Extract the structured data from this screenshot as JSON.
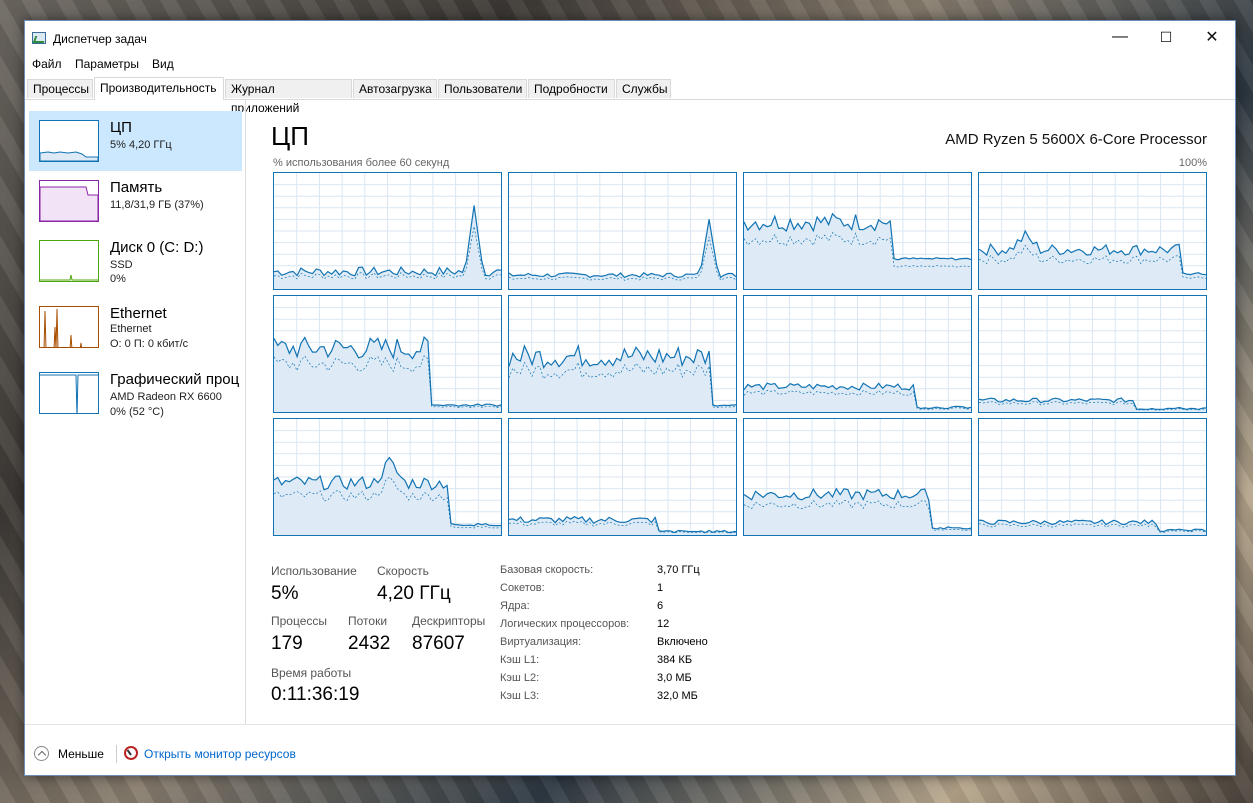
{
  "window": {
    "title": "Диспетчер задач",
    "minimize_glyph": "—",
    "maximize_glyph": "☐",
    "close_glyph": "✕"
  },
  "menu": [
    "Файл",
    "Параметры",
    "Вид"
  ],
  "tabs": [
    "Процессы",
    "Производительность",
    "Журнал приложений",
    "Автозагрузка",
    "Пользователи",
    "Подробности",
    "Службы"
  ],
  "active_tab": "Производительность",
  "sidebar": [
    {
      "name": "ЦП",
      "sub1": "5% 4,20 ГГц",
      "sub2": "",
      "sub3": "",
      "color": "#1173b3",
      "selected": true
    },
    {
      "name": "Память",
      "sub1": "11,8/31,9 ГБ (37%)",
      "sub2": "",
      "sub3": "",
      "color": "#8b25a8",
      "selected": false
    },
    {
      "name": "Диск 0 (C: D:)",
      "sub1": "SSD",
      "sub2": "0%",
      "sub3": "",
      "color": "#4da60c",
      "selected": false
    },
    {
      "name": "Ethernet",
      "sub1": "Ethernet",
      "sub2": "О: 0 П: 0 кбит/с",
      "sub3": "",
      "color": "#a74f01",
      "selected": false
    },
    {
      "name": "Графический проц",
      "sub1": "AMD Radeon RX 6600",
      "sub2": "0% (52 °C)",
      "sub3": "",
      "color": "#1173b3",
      "selected": false
    }
  ],
  "main": {
    "title": "ЦП",
    "cpu_name": "AMD Ryzen 5 5600X 6-Core Processor",
    "caption_left": "% использования более 60 секунд",
    "caption_right": "100%",
    "graph_count": 12,
    "colors": {
      "line": "#1173b3",
      "fill": "#deebf6",
      "grid": "#d9e6f2"
    }
  },
  "stats": {
    "usage_label": "Использование",
    "usage_value": "5%",
    "speed_label": "Скорость",
    "speed_value": "4,20 ГГц",
    "processes_label": "Процессы",
    "processes_value": "179",
    "threads_label": "Потоки",
    "threads_value": "2432",
    "handles_label": "Дескрипторы",
    "handles_value": "87607",
    "uptime_label": "Время работы",
    "uptime_value": "0:11:36:19"
  },
  "info": [
    {
      "label": "Базовая скорость:",
      "value": "3,70 ГГц"
    },
    {
      "label": "Сокетов:",
      "value": "1"
    },
    {
      "label": "Ядра:",
      "value": "6"
    },
    {
      "label": "Логических процессоров:",
      "value": "12"
    },
    {
      "label": "Виртуализация:",
      "value": "Включено"
    },
    {
      "label": "Кэш L1:",
      "value": "384 КБ"
    },
    {
      "label": "Кэш L2:",
      "value": "3,0 МБ"
    },
    {
      "label": "Кэш L3:",
      "value": "32,0 МБ"
    }
  ],
  "footer": {
    "less_label": "Меньше",
    "monitor_link": "Открыть монитор ресурсов"
  }
}
